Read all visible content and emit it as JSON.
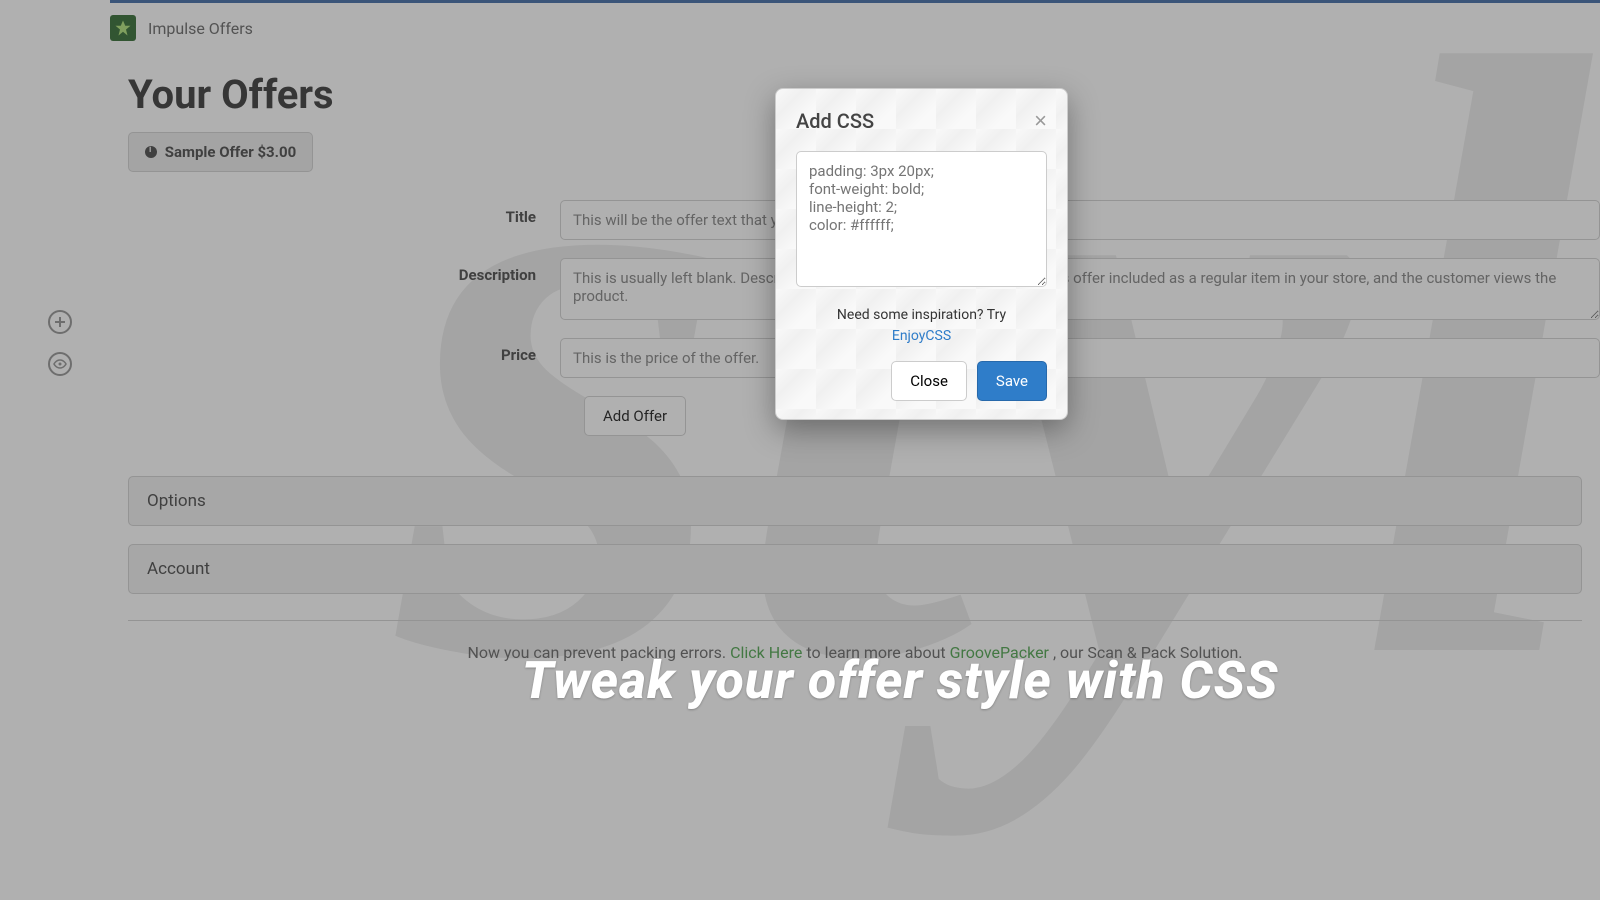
{
  "brand": "Impulse Offers",
  "page_title": "Your Offers",
  "sample_offer": "Sample Offer $3.00",
  "form": {
    "title_label": "Title",
    "title_placeholder": "This will be the offer text that your customer sees in the cart page.",
    "description_label": "Description",
    "description_placeholder": "This is usually left blank. Description text only appears if you also have this offer included as a regular item in your store, and the customer views the product.",
    "price_label": "Price",
    "price_placeholder": "This is the price of the offer.",
    "add_offer_label": "Add Offer"
  },
  "panels": {
    "options": "Options",
    "account": "Account"
  },
  "footer": {
    "pre": "Now you can prevent packing errors. ",
    "click_here": "Click Here",
    "mid": " to learn more about ",
    "groove": "GroovePacker",
    "post": ", our Scan & Pack Solution."
  },
  "tagline": "Tweak your offer style with CSS",
  "modal": {
    "title": "Add CSS",
    "textarea_placeholder": "padding: 3px 20px;\nfont-weight: bold;\nline-height: 2;\ncolor: #ffffff;",
    "help_text": "Need some inspiration? Try",
    "help_link": "EnjoyCSS",
    "close_label": "Close",
    "save_label": "Save"
  }
}
